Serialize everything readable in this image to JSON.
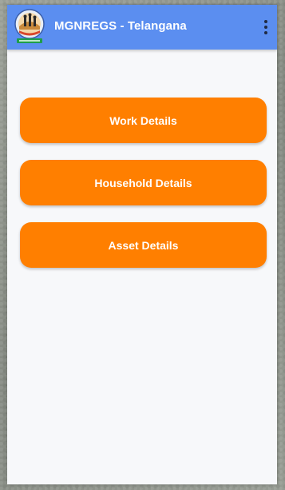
{
  "app_bar": {
    "title": "MGNREGS - Telangana",
    "background_color": "#5b8ef0",
    "logo_icon": "mgnregs-telangana-logo",
    "menu_icon": "more-vertical-icon"
  },
  "menu": {
    "accent_color": "#ff7f00",
    "buttons": [
      {
        "label": "Work Details"
      },
      {
        "label": "Household Details"
      },
      {
        "label": "Asset Details"
      }
    ]
  }
}
